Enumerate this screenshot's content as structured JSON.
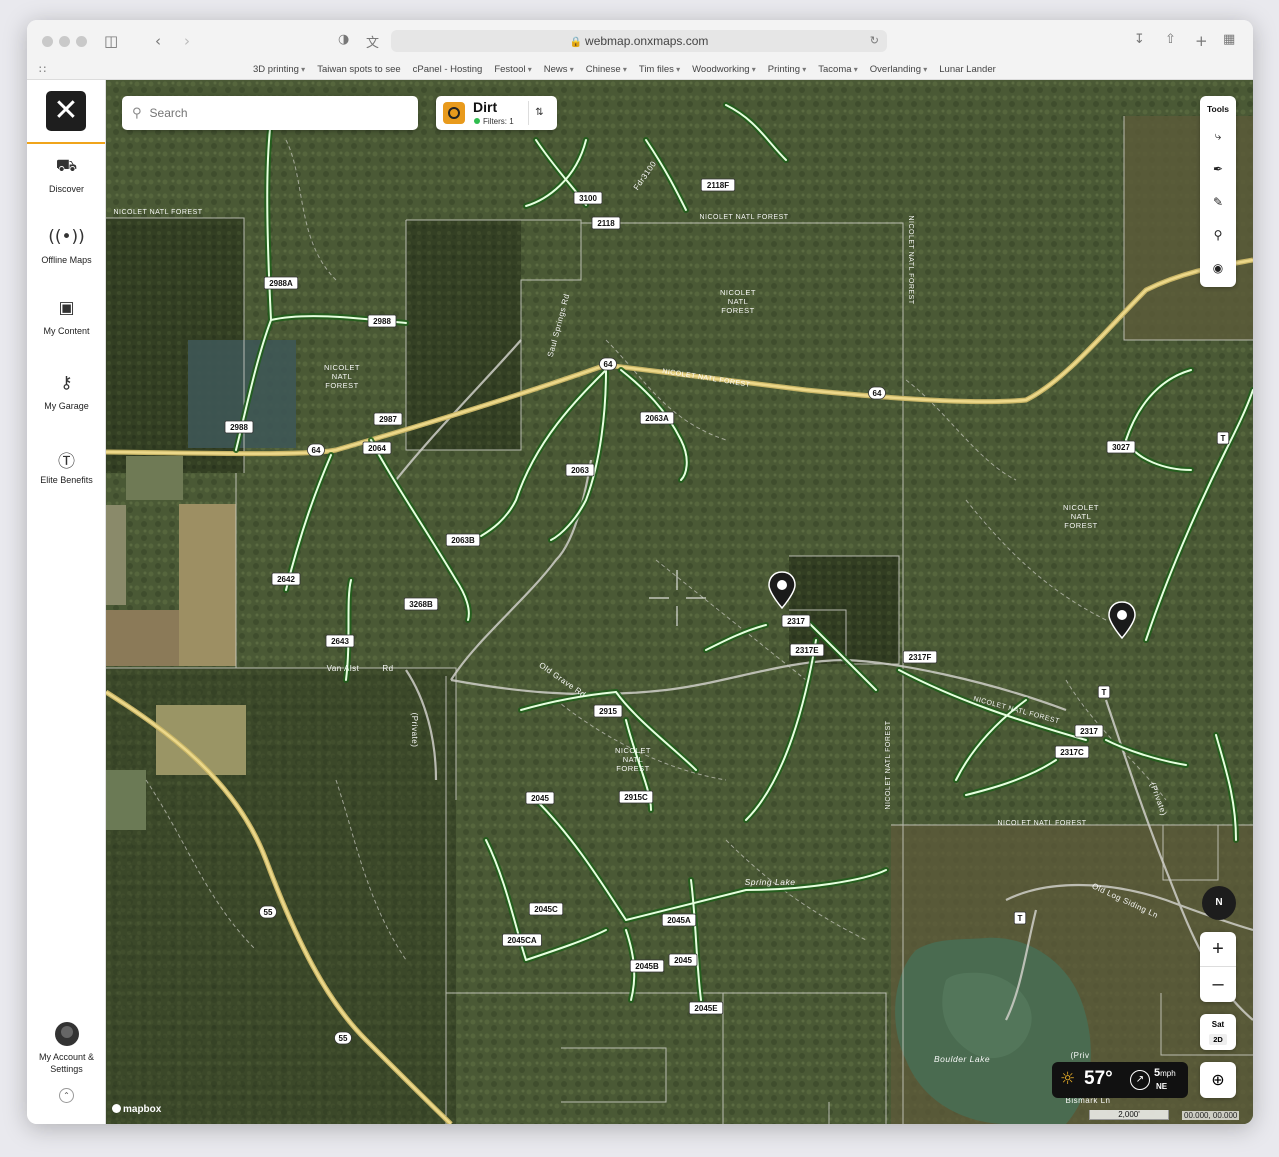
{
  "browser": {
    "url": "webmap.onxmaps.com",
    "bookmarks": [
      {
        "label": "3D printing",
        "dropdown": true
      },
      {
        "label": "Taiwan spots to see",
        "dropdown": false
      },
      {
        "label": "cPanel - Hosting",
        "dropdown": false
      },
      {
        "label": "Festool",
        "dropdown": true
      },
      {
        "label": "News",
        "dropdown": true
      },
      {
        "label": "Chinese",
        "dropdown": true
      },
      {
        "label": "Tim files",
        "dropdown": true
      },
      {
        "label": "Woodworking",
        "dropdown": true
      },
      {
        "label": "Printing",
        "dropdown": true
      },
      {
        "label": "Tacoma",
        "dropdown": true
      },
      {
        "label": "Overlanding",
        "dropdown": true
      },
      {
        "label": "Lunar Lander",
        "dropdown": false
      }
    ]
  },
  "sidebar": {
    "items": [
      {
        "label": "Discover",
        "icon": "discover-icon"
      },
      {
        "label": "Offline Maps",
        "icon": "offline-maps-icon"
      },
      {
        "label": "My Content",
        "icon": "folder-icon"
      },
      {
        "label": "My Garage",
        "icon": "garage-keys-icon"
      },
      {
        "label": "Elite Benefits",
        "icon": "dollar-icon"
      }
    ],
    "account_line1": "My Account &",
    "account_line2": "Settings"
  },
  "search": {
    "placeholder": "Search"
  },
  "layer": {
    "title": "Dirt",
    "filters": "Filters: 1",
    "status_color": "#2ebd4e"
  },
  "tools": {
    "title": "Tools"
  },
  "compass": {
    "label": "N"
  },
  "map_style": {
    "layer": "Sat",
    "mode": "2D"
  },
  "weather": {
    "temp": "57°",
    "wind_speed": "5",
    "wind_unit": "mph",
    "wind_dir": "NE"
  },
  "scale": {
    "label": "2,000'"
  },
  "coords": {
    "label": "00.000, 00.000"
  },
  "attribution": "mapbox",
  "map_labels": {
    "route_shields": [
      "3100",
      "2118",
      "2118F",
      "2988A",
      "2988",
      "2987",
      "2988",
      "64",
      "2064",
      "2063A",
      "2063",
      "2063B",
      "2642",
      "3268B",
      "2643",
      "64",
      "64",
      "3027",
      "T",
      "2317",
      "2317E",
      "2317F",
      "T",
      "2317",
      "2317C",
      "2915",
      "2915C",
      "2045",
      "2045C",
      "2045CA",
      "2045A",
      "2045B",
      "2045",
      "2045E",
      "55",
      "55",
      "T"
    ],
    "area_labels": [
      "NICOLET NATL FOREST",
      "NICOLET NATL FOREST",
      "NICOLET NATL FOREST",
      "NICOLET NATL FOREST",
      "NICOLET NATL FOREST",
      "NICOLET NATL FOREST"
    ],
    "forest_line_labels": [
      "NICOLET NATL FOREST",
      "NICOLET NATL FOREST",
      "NICOLET NATL FOREST",
      "NICOLET NATL FOREST",
      "NICOLET NATL FOREST",
      "NICOLET NATL FOREST",
      "NICOLET NATL FOREST"
    ],
    "road_names": [
      "Saul Springs Rd",
      "Fdr3100",
      "Van Alst",
      "Rd",
      "Old Grave Rd",
      "(Private)",
      "(Private)",
      "Old Log Siding Ln",
      "Bismark Ln",
      "(Priv"
    ],
    "water_labels": [
      "Spring Lake",
      "Boulder Lake"
    ]
  }
}
